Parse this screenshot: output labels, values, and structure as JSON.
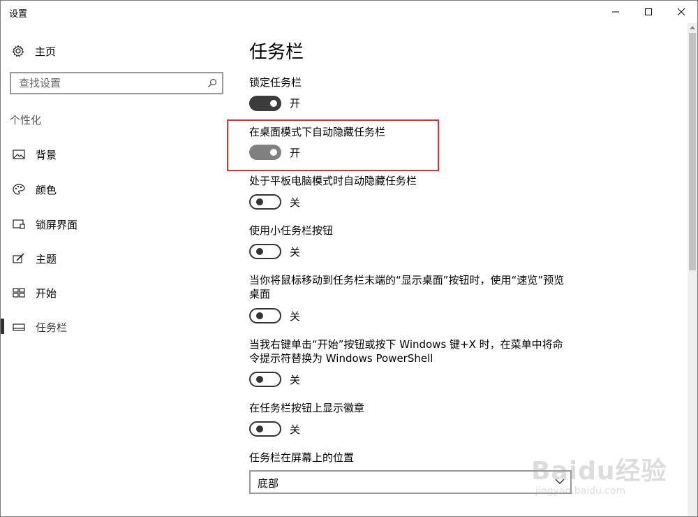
{
  "window": {
    "title": "设置"
  },
  "sidebar": {
    "home_label": "主页",
    "search_placeholder": "查找设置",
    "group_heading": "个性化",
    "items": [
      {
        "label": "背景",
        "icon": "image-icon"
      },
      {
        "label": "颜色",
        "icon": "palette-icon"
      },
      {
        "label": "锁屏界面",
        "icon": "lock-screen-icon"
      },
      {
        "label": "主题",
        "icon": "theme-icon"
      },
      {
        "label": "开始",
        "icon": "start-icon"
      },
      {
        "label": "任务栏",
        "icon": "taskbar-icon",
        "selected": true
      }
    ]
  },
  "main": {
    "title": "任务栏",
    "settings": [
      {
        "label": "锁定任务栏",
        "state": "开"
      },
      {
        "label": "在桌面模式下自动隐藏任务栏",
        "state": "开"
      },
      {
        "label": "处于平板电脑模式时自动隐藏任务栏",
        "state": "关"
      },
      {
        "label": "使用小任务栏按钮",
        "state": "关"
      },
      {
        "label": "当你将鼠标移动到任务栏末端的“显示桌面”按钮时，使用“速览”预览桌面",
        "state": "关"
      },
      {
        "label": "当我右键单击“开始”按钮或按下 Windows 键+X 时，在菜单中将命令提示符替换为 Windows PowerShell",
        "state": "关"
      },
      {
        "label": "在任务栏按钮上显示徽章",
        "state": "关"
      }
    ],
    "position_label": "任务栏在屏幕上的位置",
    "position_value": "底部"
  },
  "watermark": {
    "text": "Baidu经验",
    "sub": "jingyan.baidu.com"
  },
  "colors": {
    "highlight": "#e03030",
    "toggle_on": "#3c3c3c",
    "toggle_off_border": "#333333"
  }
}
